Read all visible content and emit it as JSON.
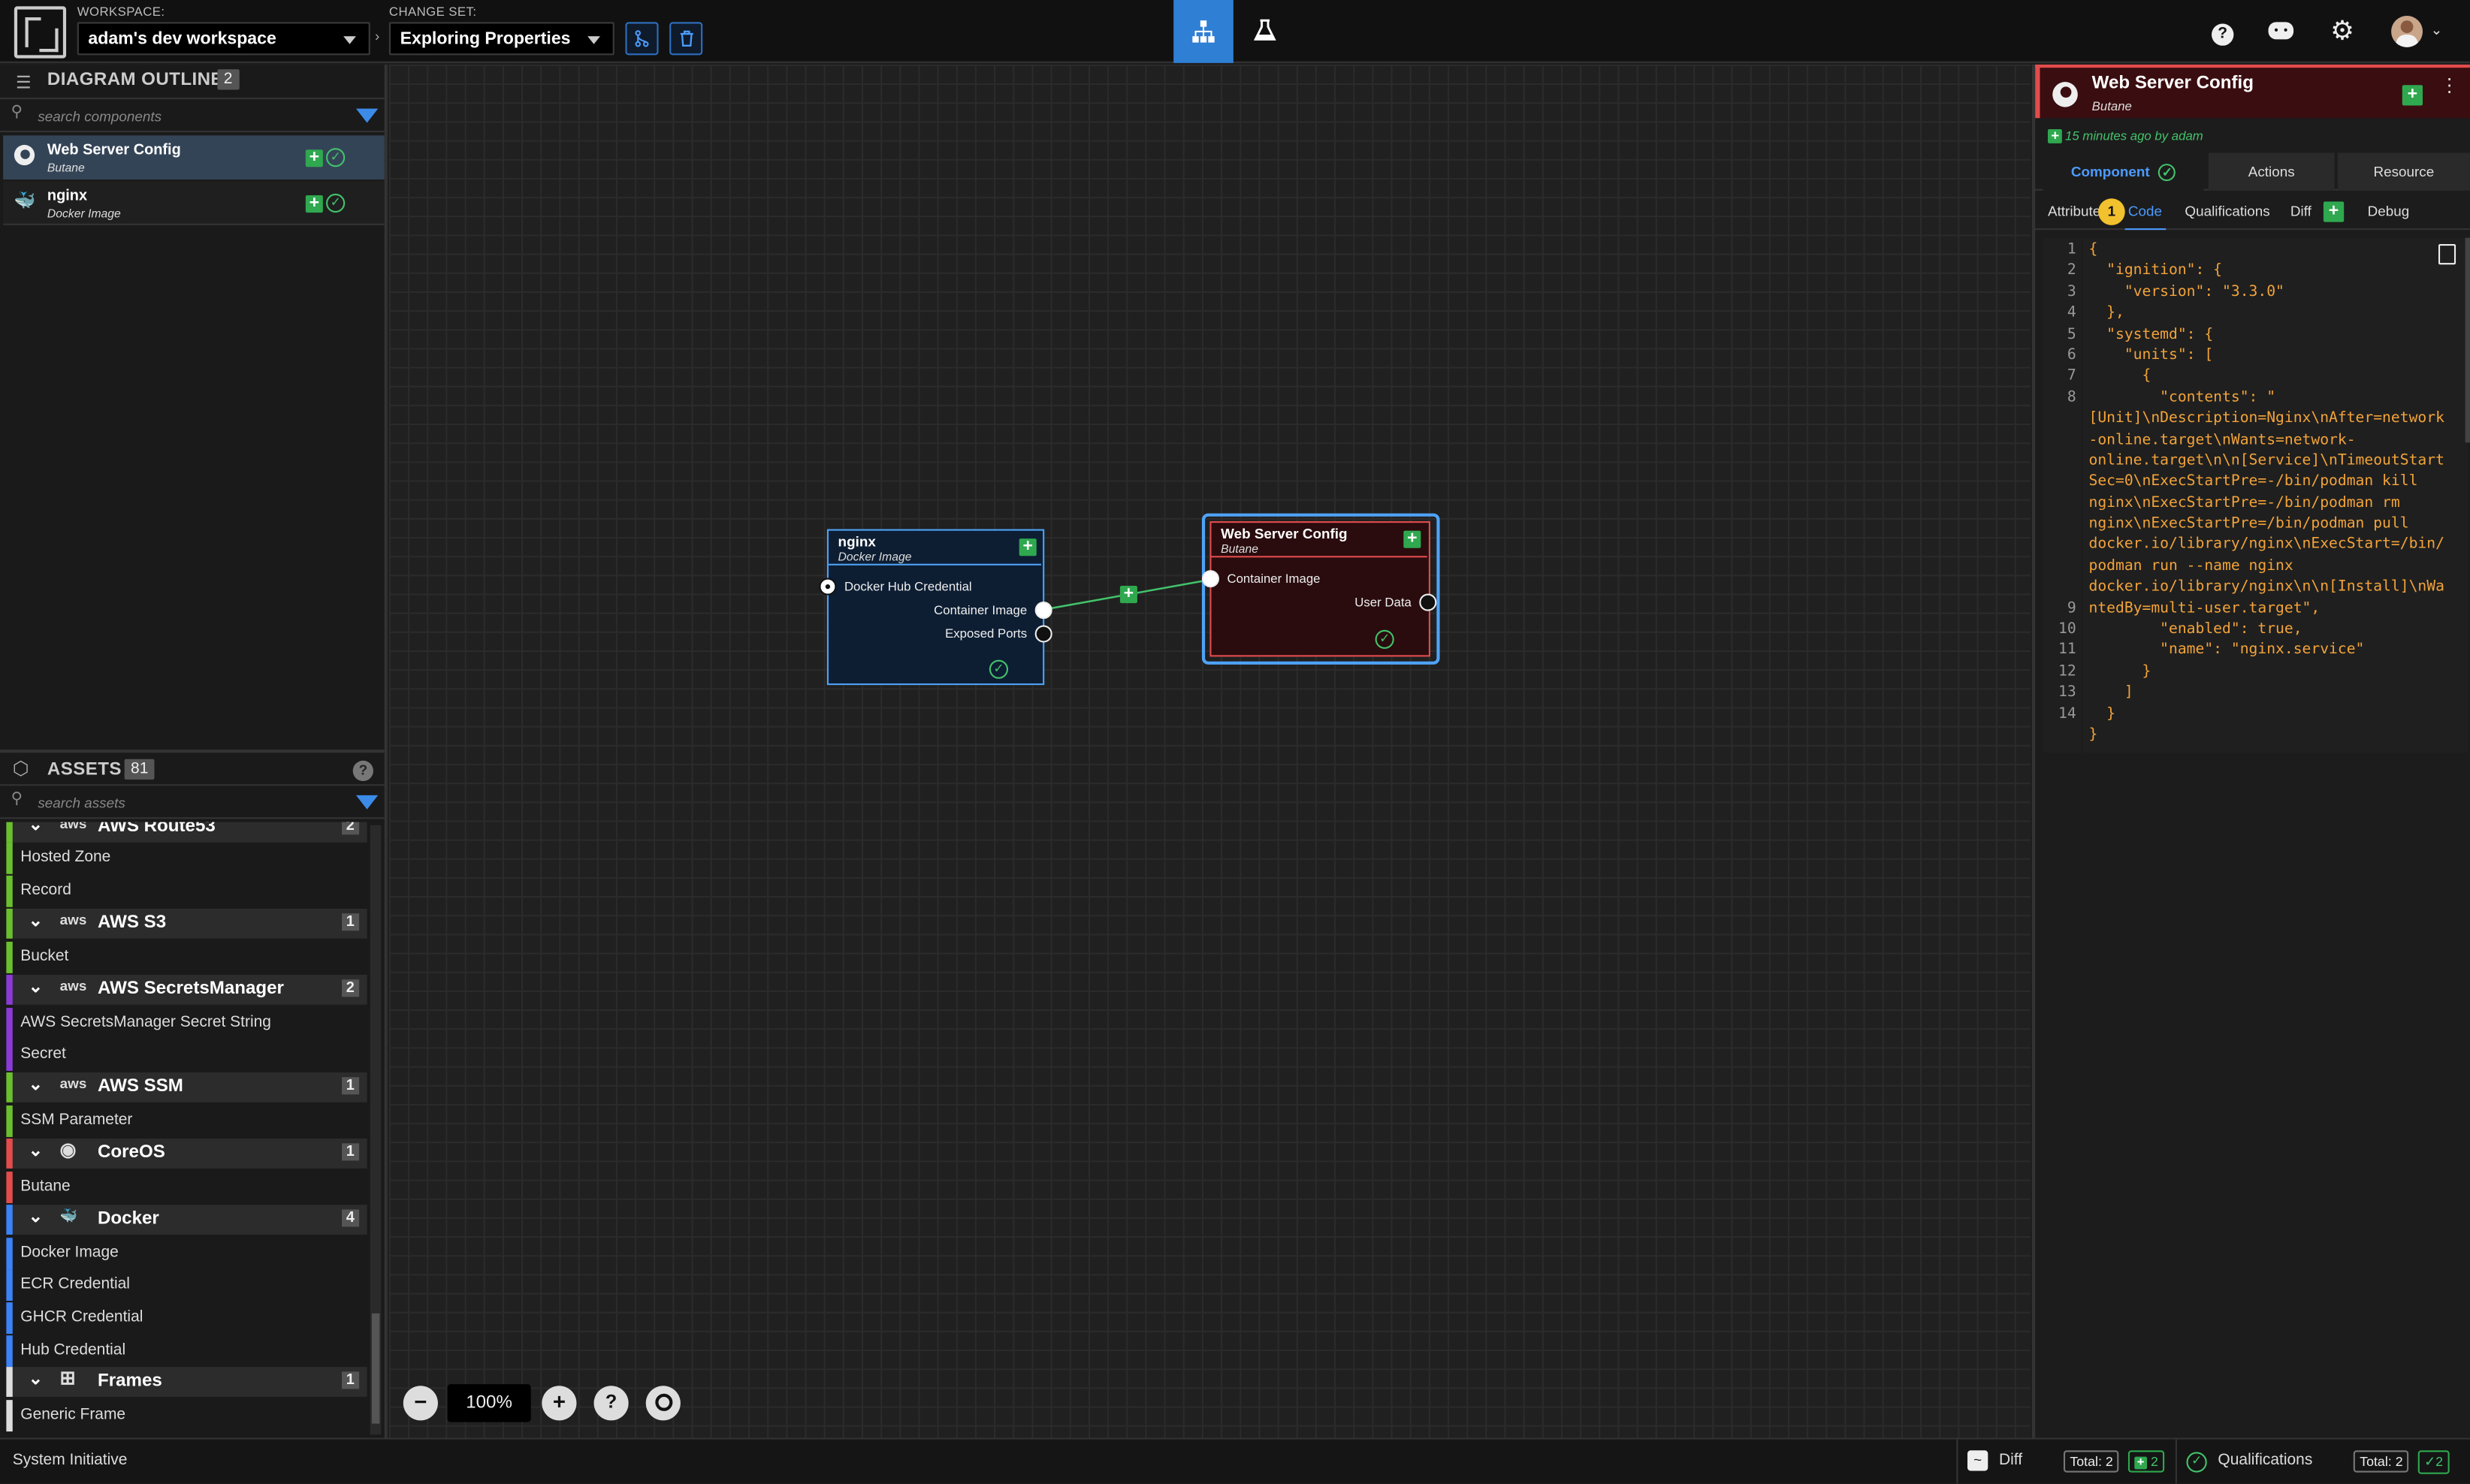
{
  "topbar": {
    "workspace_label": "WORKSPACE:",
    "workspace_value": "adam's dev workspace",
    "changeset_label": "CHANGE SET:",
    "changeset_value": "Exploring Properties",
    "merge_icon": "git-merge-icon",
    "delete_icon": "trash-icon",
    "modes": [
      "diagram-mode-icon",
      "lab-flask-icon"
    ],
    "right_icons": [
      "help-icon",
      "discord-icon",
      "gear-icon",
      "user-avatar"
    ]
  },
  "outline": {
    "title": "DIAGRAM OUTLINE",
    "count": "2",
    "search_placeholder": "search components",
    "components": [
      {
        "name": "Web Server Config",
        "type": "Butane"
      },
      {
        "name": "nginx",
        "type": "Docker Image"
      }
    ]
  },
  "assets": {
    "title": "ASSETS",
    "count": "81",
    "search_placeholder": "search assets",
    "partial_category": "AWS Route53",
    "partial_count": "2",
    "route53_items": [
      "Hosted Zone",
      "Record"
    ],
    "categories": [
      {
        "name": "AWS S3",
        "count": "1",
        "items": [
          "Bucket"
        ],
        "color": "#6abf2e"
      },
      {
        "name": "AWS SecretsManager",
        "count": "2",
        "items": [
          "AWS SecretsManager Secret String",
          "Secret"
        ],
        "color": "#8a3bd6"
      },
      {
        "name": "AWS SSM",
        "count": "1",
        "items": [
          "SSM Parameter"
        ],
        "color": "#6abf2e"
      },
      {
        "name": "CoreOS",
        "count": "1",
        "items": [
          "Butane"
        ],
        "color": "#e24c4c"
      },
      {
        "name": "Docker",
        "count": "4",
        "items": [
          "Docker Image",
          "ECR Credential",
          "GHCR Credential",
          "Hub Credential"
        ],
        "color": "#3b82f6"
      },
      {
        "name": "Frames",
        "count": "1",
        "items": [
          "Generic Frame"
        ],
        "color": "#dddddd"
      }
    ]
  },
  "canvas": {
    "zoom": "100%",
    "nginx_node": {
      "title": "nginx",
      "subtitle": "Docker Image",
      "input_socket": "Docker Hub Credential",
      "output_sockets": [
        "Container Image",
        "Exposed Ports"
      ]
    },
    "web_node": {
      "title": "Web Server Config",
      "subtitle": "Butane",
      "input_socket": "Container Image",
      "output_socket": "User Data"
    }
  },
  "details": {
    "title": "Web Server Config",
    "subtitle": "Butane",
    "updated": "15 minutes ago by adam",
    "tabs": [
      "Component",
      "Actions",
      "Resource"
    ],
    "subtabs": [
      "Attributes",
      "Code",
      "Qualifications",
      "Diff",
      "Debug"
    ],
    "code_badge": "1",
    "line_numbers": [
      "1",
      "2",
      "3",
      "4",
      "5",
      "6",
      "7",
      "8",
      "",
      "",
      "",
      "",
      "",
      "",
      "",
      "",
      "",
      "9",
      "10",
      "11",
      "12",
      "13",
      "14"
    ],
    "code_lines": [
      "{",
      "  \"ignition\": {",
      "    \"version\": \"3.3.0\"",
      "  },",
      "  \"systemd\": {",
      "    \"units\": [",
      "      {",
      "        \"contents\": \"",
      "[Unit]\\nDescription=Nginx\\nAfter=network",
      "-online.target\\nWants=network-",
      "online.target\\n\\n[Service]\\nTimeoutStart",
      "Sec=0\\nExecStartPre=-/bin/podman kill",
      "nginx\\nExecStartPre=-/bin/podman rm",
      "nginx\\nExecStartPre=/bin/podman pull",
      "docker.io/library/nginx\\nExecStart=/bin/",
      "podman run --name nginx",
      "docker.io/library/nginx\\n\\n[Install]\\nWa",
      "ntedBy=multi-user.target\",",
      "        \"enabled\": true,",
      "        \"name\": \"nginx.service\"",
      "      }",
      "    ]",
      "  }",
      "}"
    ]
  },
  "status": {
    "app_name": "System Initiative",
    "diff_label": "Diff",
    "diff_total": "Total: 2",
    "diff_added": "2",
    "qual_label": "Qualifications",
    "qual_total": "Total: 2",
    "qual_ok": "2"
  },
  "colors": {
    "accent": "#3c8be8",
    "success": "#2fa84f",
    "node_red": "#e24c4c",
    "selected": "#4fa3f7"
  }
}
